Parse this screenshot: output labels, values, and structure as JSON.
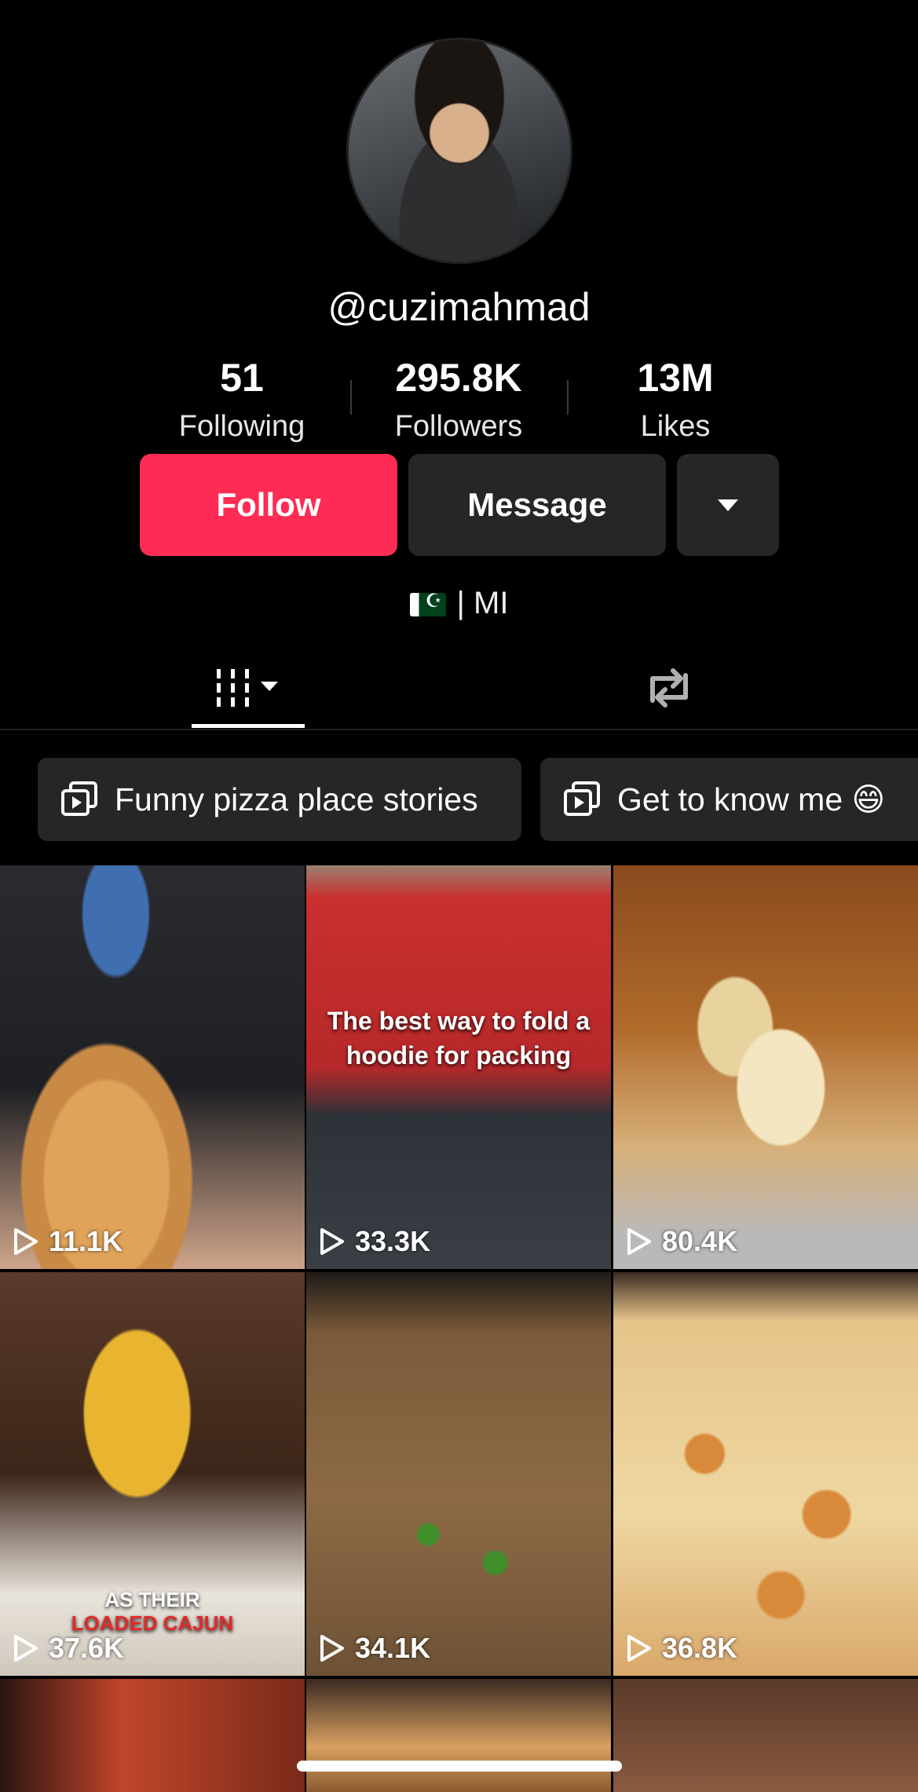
{
  "profile": {
    "username": "@cuzimahmad",
    "stats": [
      {
        "value": "51",
        "label": "Following"
      },
      {
        "value": "295.8K",
        "label": "Followers"
      },
      {
        "value": "13M",
        "label": "Likes"
      }
    ],
    "bio": "| MI"
  },
  "actions": {
    "follow_label": "Follow",
    "message_label": "Message"
  },
  "tabs": {
    "videos_icon": "grid-icon",
    "reposts_icon": "repost-icon"
  },
  "playlists": [
    {
      "label": "Funny pizza place stories"
    },
    {
      "label": "Get to know me 😄"
    }
  ],
  "videos": [
    {
      "views": "11.1K",
      "caption": ""
    },
    {
      "views": "33.3K",
      "caption_line1": "The best way to fold a",
      "caption_line2": "hoodie for packing"
    },
    {
      "views": "80.4K",
      "caption": ""
    },
    {
      "views": "37.6K",
      "caption_line1": "AS THEIR",
      "caption_line2": "LOADED CAJUN"
    },
    {
      "views": "34.1K",
      "caption": ""
    },
    {
      "views": "36.8K",
      "caption": ""
    }
  ],
  "colors": {
    "accent": "#fe2c55",
    "button_dark": "#262626",
    "background": "#000000"
  }
}
